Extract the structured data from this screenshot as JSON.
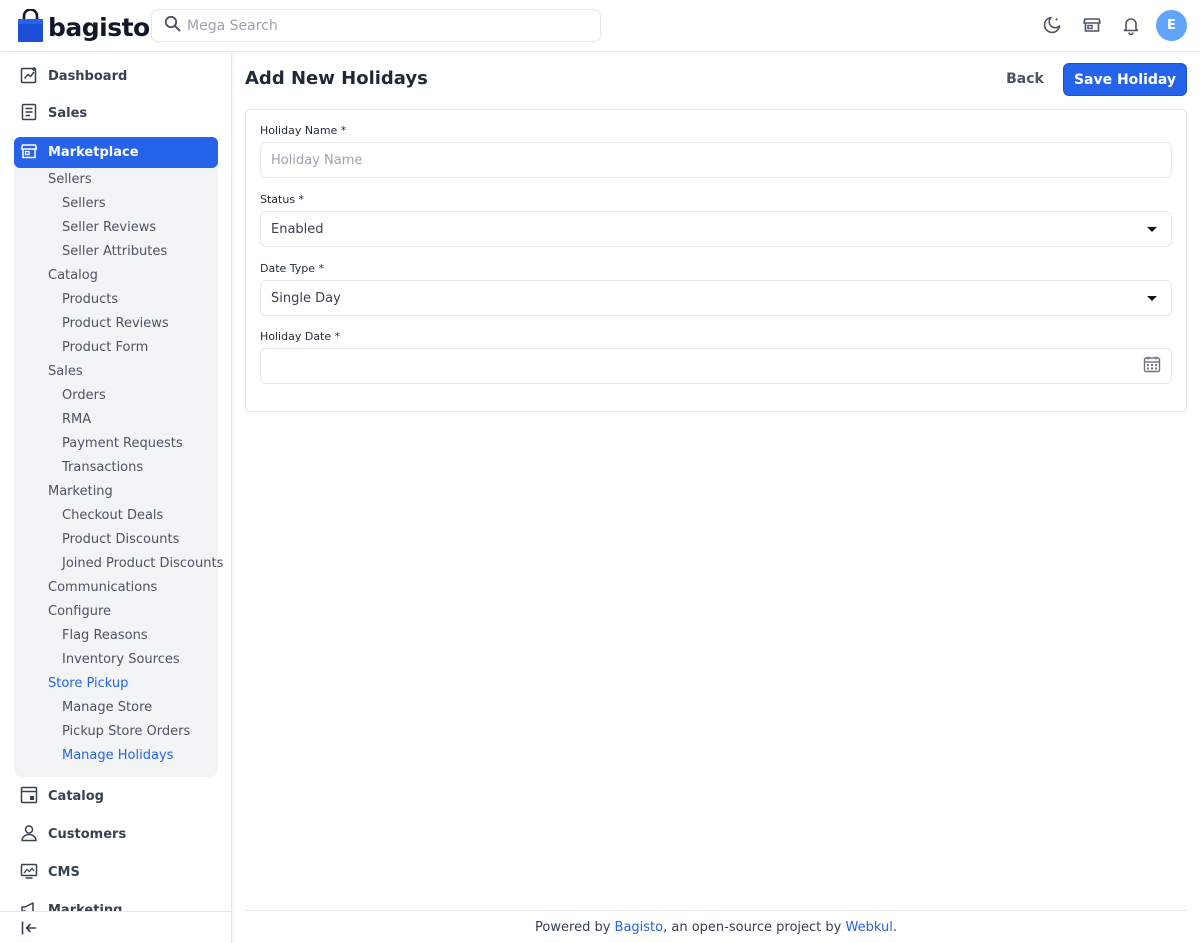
{
  "header": {
    "brand": "bagisto",
    "search_placeholder": "Mega Search",
    "avatar_initial": "E"
  },
  "sidebar": {
    "top_items": [
      {
        "label": "Dashboard",
        "icon": "dashboard-icon"
      },
      {
        "label": "Sales",
        "icon": "receipt-icon"
      },
      {
        "label": "Marketplace",
        "icon": "store-icon",
        "active": true
      },
      {
        "label": "Catalog",
        "icon": "catalog-icon"
      },
      {
        "label": "Customers",
        "icon": "user-icon"
      },
      {
        "label": "CMS",
        "icon": "monitor-icon"
      },
      {
        "label": "Marketing",
        "icon": "megaphone-icon"
      }
    ],
    "marketplace_sub": [
      {
        "label": "Sellers",
        "level": 1
      },
      {
        "label": "Sellers",
        "level": 2
      },
      {
        "label": "Seller Reviews",
        "level": 2
      },
      {
        "label": "Seller Attributes",
        "level": 2
      },
      {
        "label": "Catalog",
        "level": 1
      },
      {
        "label": "Products",
        "level": 2
      },
      {
        "label": "Product Reviews",
        "level": 2
      },
      {
        "label": "Product Form",
        "level": 2
      },
      {
        "label": "Sales",
        "level": 1
      },
      {
        "label": "Orders",
        "level": 2
      },
      {
        "label": "RMA",
        "level": 2
      },
      {
        "label": "Payment Requests",
        "level": 2
      },
      {
        "label": "Transactions",
        "level": 2
      },
      {
        "label": "Marketing",
        "level": 1
      },
      {
        "label": "Checkout Deals",
        "level": 2
      },
      {
        "label": "Product Discounts",
        "level": 2
      },
      {
        "label": "Joined Product Discounts",
        "level": 2
      },
      {
        "label": "Communications",
        "level": 1
      },
      {
        "label": "Configure",
        "level": 1
      },
      {
        "label": "Flag Reasons",
        "level": 2
      },
      {
        "label": "Inventory Sources",
        "level": 2
      },
      {
        "label": "Store Pickup",
        "level": 1,
        "active": true
      },
      {
        "label": "Manage Store",
        "level": 2
      },
      {
        "label": "Pickup Store Orders",
        "level": 2
      },
      {
        "label": "Manage Holidays",
        "level": 2,
        "active": true
      }
    ]
  },
  "page": {
    "title": "Add New Holidays",
    "back_label": "Back",
    "save_label": "Save Holiday"
  },
  "form": {
    "holiday_name": {
      "label": "Holiday Name *",
      "placeholder": "Holiday Name",
      "value": ""
    },
    "status": {
      "label": "Status *",
      "value": "Enabled"
    },
    "date_type": {
      "label": "Date Type *",
      "value": "Single Day"
    },
    "holiday_date": {
      "label": "Holiday Date *",
      "value": ""
    }
  },
  "footer": {
    "prefix": "Powered by ",
    "link1": "Bagisto",
    "middle": ", an open-source project by ",
    "link2": "Webkul",
    "suffix": "."
  },
  "colors": {
    "accent": "#2563eb",
    "avatar": "#60a5fa",
    "submenu_bg": "#f3f4f6"
  }
}
